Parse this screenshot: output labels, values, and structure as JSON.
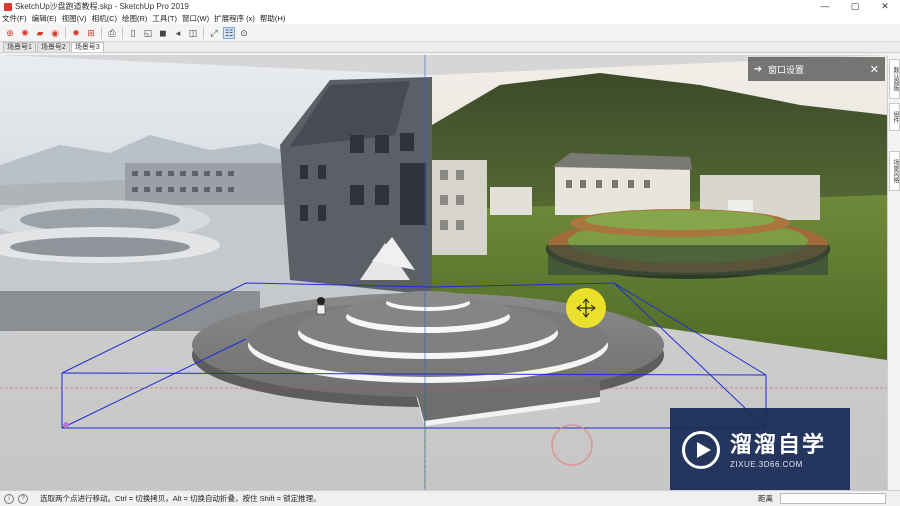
{
  "window": {
    "title": "SketchUp沙盘跑道教程.skp - SketchUp Pro 2019",
    "minimize": "—",
    "maximize": "▢",
    "close": "✕"
  },
  "menu": {
    "items": [
      "文件(F)",
      "编辑(E)",
      "视图(V)",
      "相机(C)",
      "绘图(R)",
      "工具(T)",
      "窗口(W)",
      "扩展程序 (x)",
      "帮助(H)"
    ]
  },
  "toolbar": {
    "icons": [
      "warehouse-icon",
      "extension-icon",
      "folder-icon",
      "sketchup-icon",
      "settings-icon",
      "component-icon",
      "print-icon",
      "section-plane-icon",
      "paint-bucket-icon",
      "display-section-icon",
      "cut-icon",
      "display-cut-icon",
      "walk-icon",
      "position-camera-icon",
      "lookaround-icon"
    ]
  },
  "scenes": {
    "tabs": [
      "场景号1",
      "场景号2",
      "场景号3"
    ],
    "active": 2
  },
  "panel": {
    "title": "窗口设置",
    "arrow": "➔",
    "close": "✕"
  },
  "tray": {
    "buttons": [
      "默认面板",
      "组件",
      "场景风格"
    ]
  },
  "watermark": {
    "brand": "溜溜自学",
    "url": "ZIXUE.3D66.COM"
  },
  "statusbar": {
    "hint": "选取两个点进行移动。Ctrl = 切换拷贝，Alt = 切换自动折叠，按住 Shift = 锁定推理。",
    "measure_label": "距离",
    "measure_value": ""
  },
  "colors": {
    "accent": "#d83a2e",
    "selection": "#1f2fd0",
    "cursor": "#f2e62a",
    "watermark_bg": "#182a56"
  }
}
